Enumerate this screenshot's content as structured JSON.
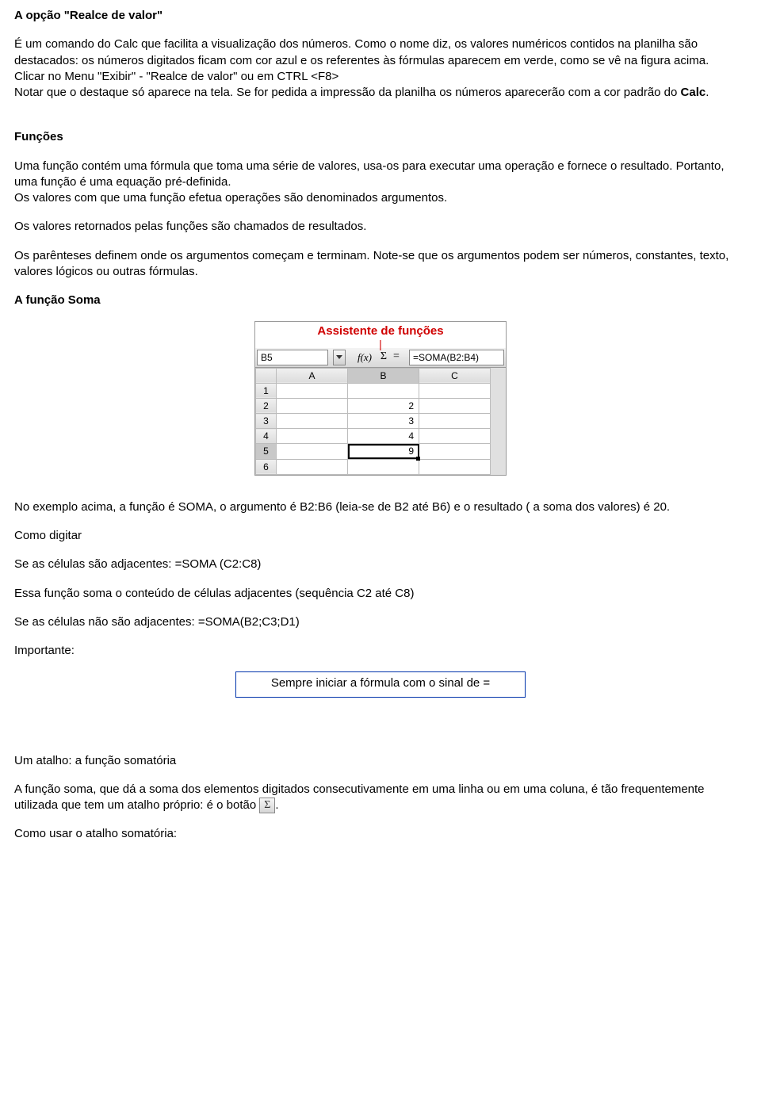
{
  "h1": "A opção \"Realce de valor\"",
  "p1a": "É um comando do Calc que facilita a visualização dos números. Como o nome diz, os valores numéricos contidos na planilha são destacados: os números digitados ficam com cor azul e os referentes às fórmulas aparecem em verde, como se vê na figura acima.",
  "p1b": "Clicar no Menu \"Exibir\" - \"Realce de valor\" ou em CTRL <F8>",
  "p1c_prefix": "Notar que o destaque só aparece na tela. Se for pedida a impressão da planilha os números aparecerão com a cor padrão do ",
  "p1c_bold": "Calc",
  "p1c_suffix": ".",
  "h2": "Funções",
  "p2a": "Uma função contém uma fórmula que toma uma série de valores, usa-os para executar uma operação e fornece o resultado. Portanto, uma função é uma equação pré-definida.",
  "p2b": "Os valores com que uma função efetua operações são denominados argumentos.",
  "p2c": "Os valores retornados pelas funções são chamados de resultados.",
  "p2d": "Os parênteses definem onde os argumentos começam e terminam. Note-se que os argumentos podem ser números, constantes, texto, valores lógicos ou outras fórmulas.",
  "h3": "A função Soma",
  "ss": {
    "caption": "Assistente de funções",
    "namebox": "B5",
    "fx": "f(x)",
    "sigma": "Σ",
    "eq": "=",
    "formula": "=SOMA(B2:B4)",
    "cols": [
      "A",
      "B",
      "C"
    ],
    "rows": [
      {
        "n": "1",
        "A": "",
        "B": "",
        "C": ""
      },
      {
        "n": "2",
        "A": "",
        "B": "2",
        "C": ""
      },
      {
        "n": "3",
        "A": "",
        "B": "3",
        "C": ""
      },
      {
        "n": "4",
        "A": "",
        "B": "4",
        "C": ""
      },
      {
        "n": "5",
        "A": "",
        "B": "9",
        "C": ""
      },
      {
        "n": "6",
        "A": "",
        "B": "",
        "C": ""
      }
    ],
    "selected": {
      "row": "5",
      "col": "B"
    }
  },
  "p3a": "No exemplo acima, a função é SOMA, o argumento é B2:B6 (leia-se de B2 até B6) e o resultado ( a soma dos valores) é 20.",
  "p3b": "Como digitar",
  "p3c": "Se as células são adjacentes: =SOMA (C2:C8)",
  "p3d": "Essa função soma o conteúdo de células adjacentes (sequência C2 até C8)",
  "p3e": "Se as células não são adjacentes: =SOMA(B2;C3;D1)",
  "p3f": "Importante:",
  "tip": "Sempre iniciar a fórmula com o sinal de =",
  "h4": "Um atalho: a função somatória",
  "p4a_prefix": "A função soma, que dá a soma dos elementos digitados consecutivamente em uma linha ou em uma coluna, é tão frequentemente utilizada que tem um atalho próprio: é o botão ",
  "p4a_btn": "Σ",
  "p4a_suffix": ".",
  "p4b": "Como usar o atalho somatória:"
}
